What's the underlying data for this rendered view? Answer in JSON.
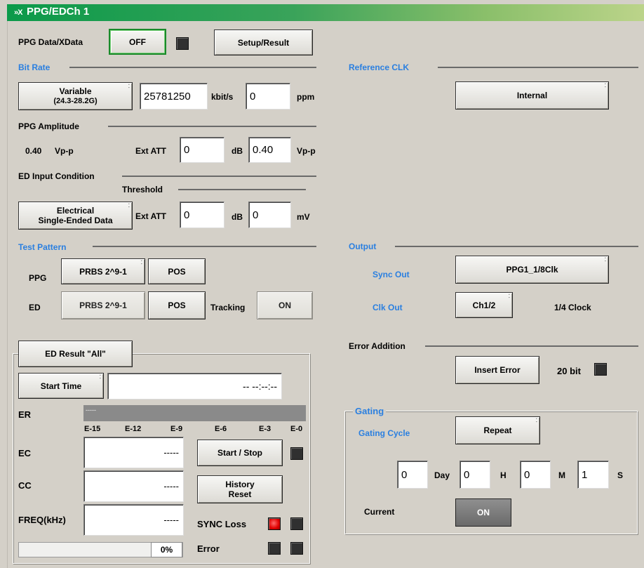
{
  "window": {
    "title": "PPG/EDCh 1",
    "icon": "close-x-icon"
  },
  "top": {
    "ppg_data_label": "PPG Data/XData",
    "off_button": "OFF",
    "setup_result_button": "Setup/Result"
  },
  "bit_rate": {
    "section": "Bit Rate",
    "variable_button_l1": "Variable",
    "variable_button_l2": "(24.3-28.2G)",
    "value": "25781250",
    "unit": "kbit/s",
    "ppm_value": "0",
    "ppm_unit": "ppm"
  },
  "reference_clk": {
    "section": "Reference CLK",
    "button": "Internal"
  },
  "ppg_amplitude": {
    "section": "PPG Amplitude",
    "value": "0.40",
    "unit": "Vp-p",
    "ext_att_label": "Ext ATT",
    "ext_att_value": "0",
    "db_unit": "dB",
    "amp_value": "0.40",
    "amp_unit": "Vp-p"
  },
  "ed_input": {
    "section": "ED Input Condition",
    "threshold_label": "Threshold",
    "button_l1": "Electrical",
    "button_l2": "Single-Ended Data",
    "ext_att_label": "Ext ATT",
    "ext_att_value": "0",
    "db_unit": "dB",
    "threshold_value": "0",
    "mv_unit": "mV"
  },
  "test_pattern": {
    "section": "Test Pattern",
    "ppg_label": "PPG",
    "ppg_pattern": "PRBS 2^9-1",
    "ppg_pos": "POS",
    "ed_label": "ED",
    "ed_pattern": "PRBS 2^9-1",
    "ed_pos": "POS",
    "tracking_label": "Tracking",
    "tracking_value": "ON"
  },
  "output": {
    "section": "Output",
    "sync_out_label": "Sync Out",
    "sync_out_value": "PPG1_1/8Clk",
    "clk_out_label": "Clk Out",
    "clk_out_value": "Ch1/2",
    "clk_out_note": "1/4 Clock"
  },
  "ed_result": {
    "button": "ED Result \"All\"",
    "start_time_button": "Start Time",
    "start_time_value": "-- --:--:--",
    "er_label": "ER",
    "er_value": "-----",
    "scale": [
      "E-15",
      "E-12",
      "E-9",
      "E-6",
      "E-3",
      "E-0"
    ],
    "ec_label": "EC",
    "ec_value": "-----",
    "cc_label": "CC",
    "cc_value": "-----",
    "freq_label": "FREQ(kHz)",
    "freq_value": "-----",
    "start_stop_button": "Start / Stop",
    "history_l1": "History",
    "history_l2": "Reset",
    "sync_loss_label": "SYNC Loss",
    "error_label": "Error",
    "progress_text": "0%",
    "progress_value": 0
  },
  "error_addition": {
    "section": "Error Addition",
    "insert_button": "Insert Error",
    "bits": "20 bit"
  },
  "gating": {
    "section": "Gating",
    "cycle_label": "Gating Cycle",
    "cycle_value": "Repeat",
    "day_value": "0",
    "day_unit": "Day",
    "h_value": "0",
    "h_unit": "H",
    "m_value": "0",
    "m_unit": "M",
    "s_value": "1",
    "s_unit": "S",
    "current_label": "Current",
    "current_value": "ON"
  },
  "colors": {
    "title_green": "#0b9a4a",
    "section_blue": "#2a7fe0",
    "led_red": "#e00000",
    "panel_gray": "#d4d0c8"
  }
}
